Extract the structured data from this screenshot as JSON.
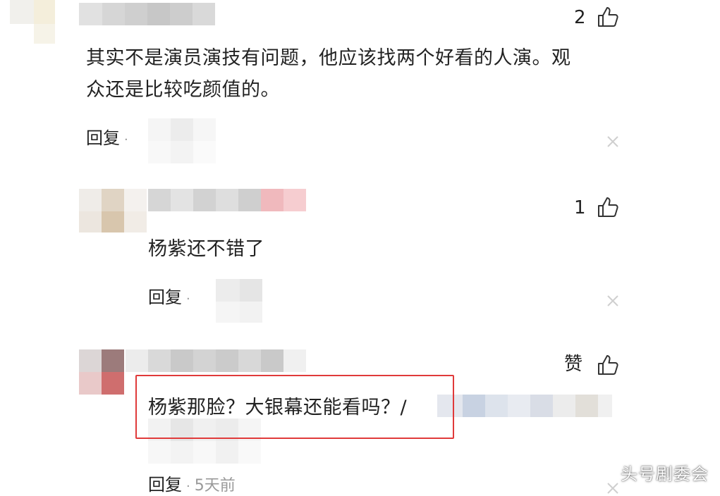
{
  "comments": [
    {
      "like_count": "2",
      "text_line1": "其实不是演员演技有问题，他应该找两个好看的人演。观",
      "text_line2": "众还是比较吃颜值的。",
      "reply_label": "回复",
      "separator": "·"
    },
    {
      "like_count": "1",
      "text": "杨紫还不错了",
      "reply_label": "回复",
      "separator": "·"
    },
    {
      "like_count": "赞",
      "text": "杨紫那脸？大银幕还能看吗？/",
      "reply_label": "回复",
      "separator": "·",
      "time": "5天前"
    }
  ],
  "icons": {
    "like": "thumbs-up-icon",
    "close": "close-icon"
  },
  "colors": {
    "highlight_border": "#e03a3a",
    "text": "#222222",
    "muted": "#999999"
  },
  "watermark": "头号剧委会"
}
